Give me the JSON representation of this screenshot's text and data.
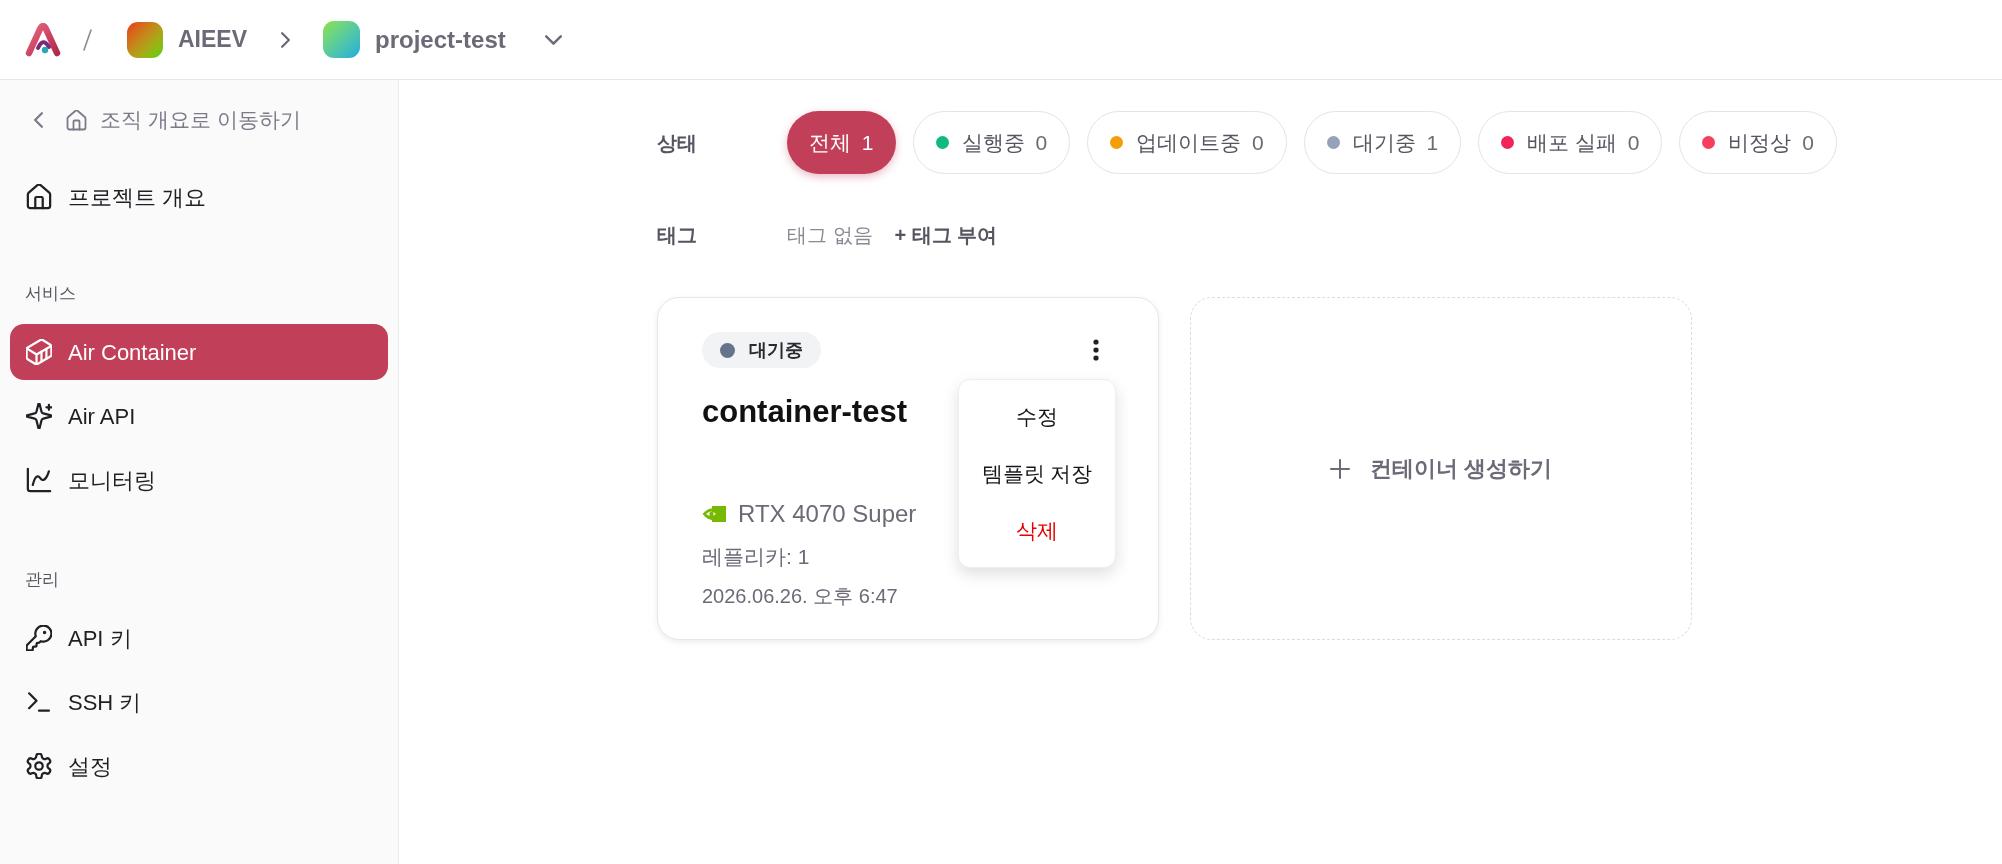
{
  "topbar": {
    "org": {
      "name": "AIEEV"
    },
    "project": {
      "name": "project-test"
    }
  },
  "sidebar": {
    "back_link": {
      "label": "조직 개요로 이동하기"
    },
    "overview": {
      "label": "프로젝트 개요",
      "selected": false
    },
    "sections": [
      {
        "title": "서비스",
        "items": [
          {
            "label": "Air Container",
            "selected": true
          },
          {
            "label": "Air API",
            "selected": false
          },
          {
            "label": "모니터링",
            "selected": false
          }
        ]
      },
      {
        "title": "관리",
        "items": [
          {
            "label": "API 키",
            "selected": false
          },
          {
            "label": "SSH 키",
            "selected": false
          },
          {
            "label": "설정",
            "selected": false
          }
        ]
      }
    ]
  },
  "filters": {
    "status": {
      "label": "상태",
      "options": [
        {
          "label": "전체",
          "count": "1",
          "selected": true
        },
        {
          "label": "실행중",
          "count": "0",
          "color": "#10b981",
          "selected": false
        },
        {
          "label": "업데이트중",
          "count": "0",
          "color": "#f59e0b",
          "selected": false
        },
        {
          "label": "대기중",
          "count": "1",
          "color": "#94a3b8",
          "selected": false
        },
        {
          "label": "배포 실패",
          "count": "0",
          "color": "#f0245a",
          "selected": false
        },
        {
          "label": "비정상",
          "count": "0",
          "color": "#f43f5e",
          "selected": false
        }
      ]
    },
    "tags": {
      "label": "태그",
      "empty_text": "태그 없음",
      "add_button": "+ 태그 부여"
    }
  },
  "containers": [
    {
      "status": {
        "label": "대기중",
        "color": "#64748b"
      },
      "name": "container-test",
      "gpu": "RTX 4070 Super",
      "replicas": "레플리카: 1",
      "created": "2026.06.26. 오후 6:47",
      "menu": {
        "open": true,
        "items": [
          {
            "label": "수정",
            "kind": "normal"
          },
          {
            "label": "템플릿 저장",
            "kind": "normal"
          },
          {
            "label": "삭제",
            "kind": "danger"
          }
        ]
      }
    }
  ],
  "create_card": {
    "label": "컨테이너 생성하기"
  }
}
